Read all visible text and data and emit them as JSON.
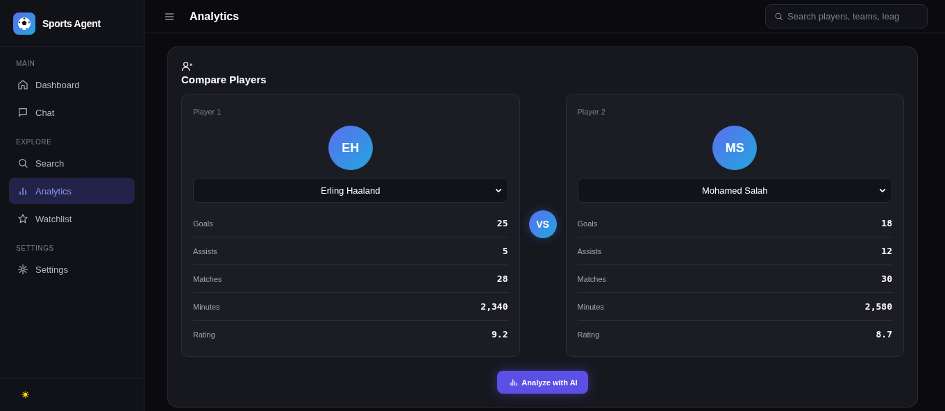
{
  "app": {
    "name": "Sports Agent"
  },
  "sidebar": {
    "sections": [
      {
        "label": "MAIN",
        "items": [
          {
            "label": "Dashboard",
            "selected": false
          },
          {
            "label": "Chat",
            "selected": false
          }
        ]
      },
      {
        "label": "EXPLORE",
        "items": [
          {
            "label": "Search",
            "selected": false
          },
          {
            "label": "Analytics",
            "selected": true
          },
          {
            "label": "Watchlist",
            "selected": false
          }
        ]
      },
      {
        "label": "SETTINGS",
        "items": [
          {
            "label": "Settings",
            "selected": false
          }
        ]
      }
    ]
  },
  "header": {
    "title": "Analytics",
    "search": {
      "placeholder": "Search players, teams, leag"
    }
  },
  "compare": {
    "title": "Compare Players",
    "vs": "VS",
    "players": [
      {
        "label": "Player 1",
        "initials": "EH",
        "name": "Erling Haaland",
        "stats": [
          {
            "label": "Goals",
            "value": "25"
          },
          {
            "label": "Assists",
            "value": "5"
          },
          {
            "label": "Matches",
            "value": "28"
          },
          {
            "label": "Minutes",
            "value": "2,340"
          },
          {
            "label": "Rating",
            "value": "9.2"
          }
        ]
      },
      {
        "label": "Player 2",
        "initials": "MS",
        "name": "Mohamed Salah",
        "stats": [
          {
            "label": "Goals",
            "value": "18"
          },
          {
            "label": "Assists",
            "value": "12"
          },
          {
            "label": "Matches",
            "value": "30"
          },
          {
            "label": "Minutes",
            "value": "2,580"
          },
          {
            "label": "Rating",
            "value": "8.7"
          }
        ]
      }
    ],
    "action": "Analyze with AI"
  }
}
